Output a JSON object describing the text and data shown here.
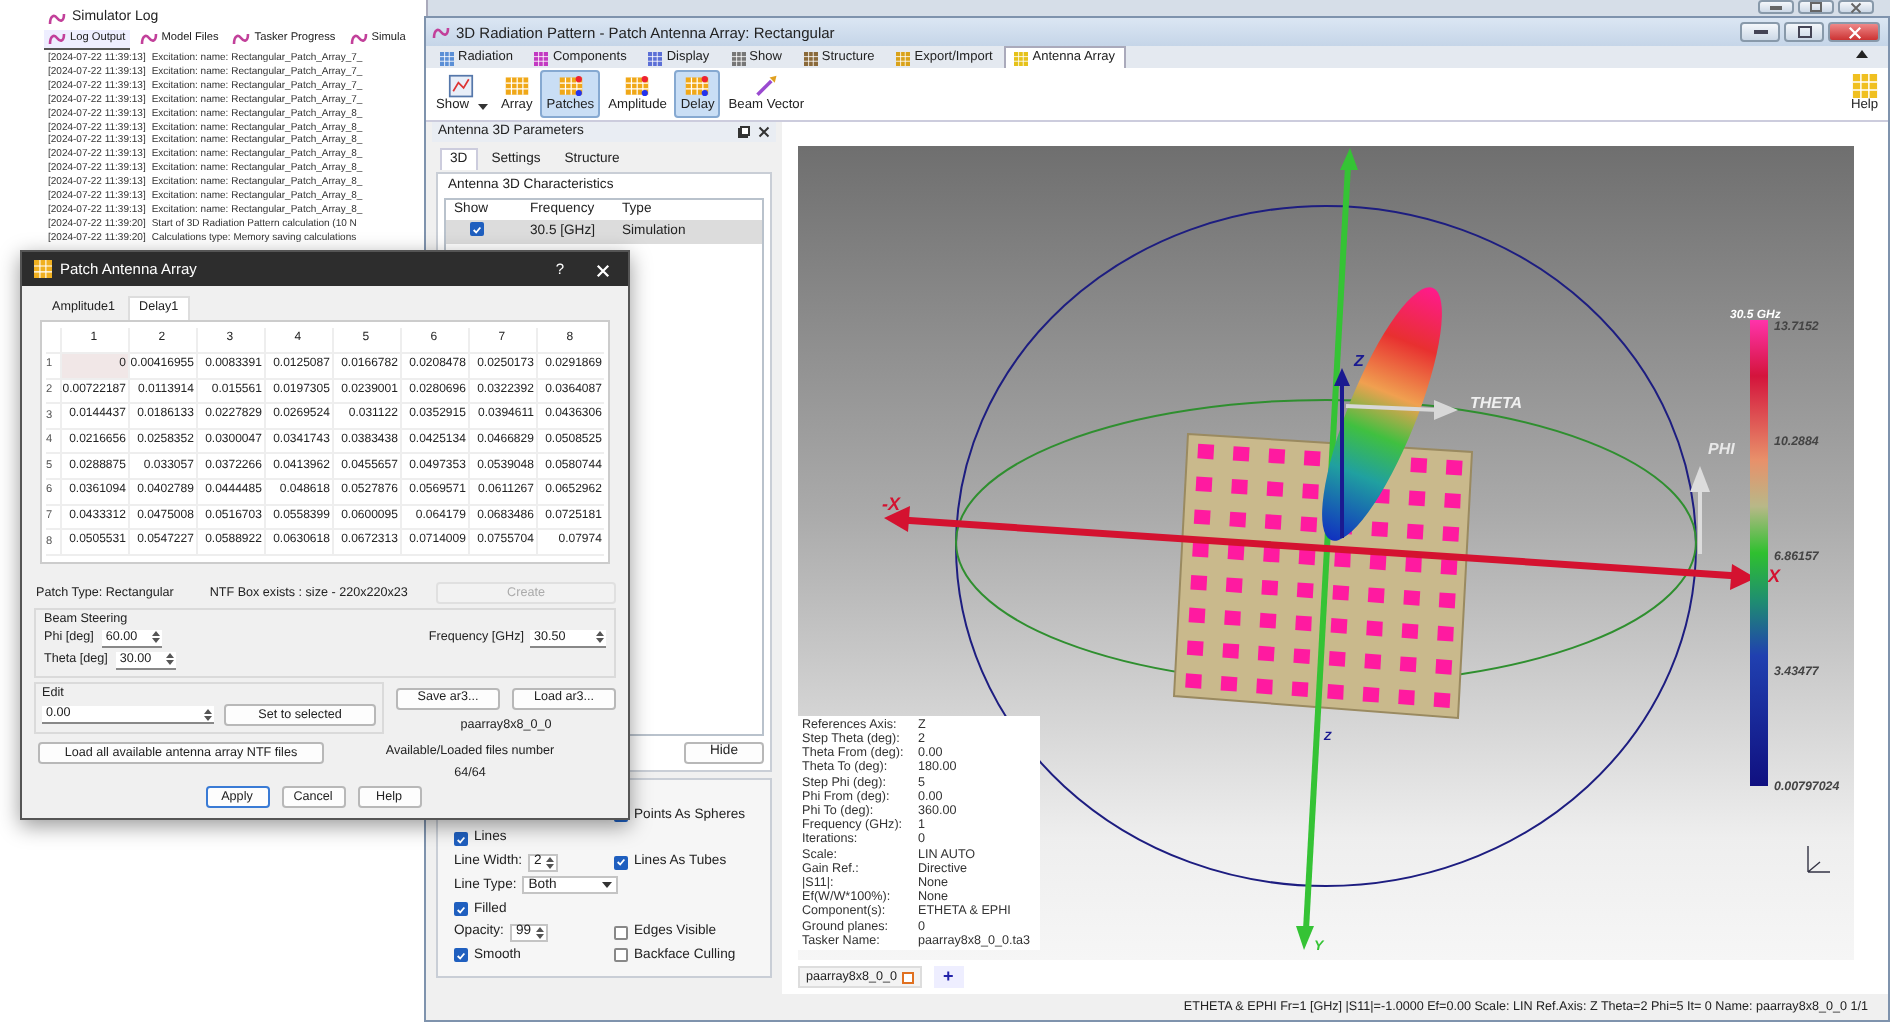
{
  "simulator_log": {
    "title": "Simulator Log",
    "tabs": [
      {
        "label": "Log Output",
        "selected": true
      },
      {
        "label": "Model Files",
        "selected": false
      },
      {
        "label": "Tasker Progress",
        "selected": false
      },
      {
        "label": "Simula",
        "selected": false
      }
    ],
    "lines": [
      {
        "time": "[2024-07-22 11:39:13]",
        "message": "Excitation: name: Rectangular_Patch_Array_7_"
      },
      {
        "time": "[2024-07-22 11:39:13]",
        "message": "Excitation: name: Rectangular_Patch_Array_7_"
      },
      {
        "time": "[2024-07-22 11:39:13]",
        "message": "Excitation: name: Rectangular_Patch_Array_7_"
      },
      {
        "time": "[2024-07-22 11:39:13]",
        "message": "Excitation: name: Rectangular_Patch_Array_7_"
      },
      {
        "time": "[2024-07-22 11:39:13]",
        "message": "Excitation: name: Rectangular_Patch_Array_8_"
      },
      {
        "time": "[2024-07-22 11:39:13]",
        "message": "Excitation: name: Rectangular_Patch_Array_8_"
      },
      {
        "time": "[2024-07-22 11:39:13]",
        "message": "Excitation: name: Rectangular_Patch_Array_8_"
      },
      {
        "time": "[2024-07-22 11:39:13]",
        "message": "Excitation: name: Rectangular_Patch_Array_8_"
      },
      {
        "time": "[2024-07-22 11:39:13]",
        "message": "Excitation: name: Rectangular_Patch_Array_8_"
      },
      {
        "time": "[2024-07-22 11:39:13]",
        "message": "Excitation: name: Rectangular_Patch_Array_8_"
      },
      {
        "time": "[2024-07-22 11:39:13]",
        "message": "Excitation: name: Rectangular_Patch_Array_8_"
      },
      {
        "time": "[2024-07-22 11:39:13]",
        "message": "Excitation: name: Rectangular_Patch_Array_8_"
      },
      {
        "time": "[2024-07-22 11:39:20]",
        "message": "Start of 3D Radiation Pattern calculation (10 N"
      },
      {
        "time": "[2024-07-22 11:39:20]",
        "message": "Calculations type: Memory saving calculations"
      }
    ]
  },
  "main_window": {
    "title": "3D Radiation Pattern - Patch Antenna Array: Rectangular",
    "ribbon_tabs": [
      {
        "label": "Radiation",
        "selected": false
      },
      {
        "label": "Components",
        "selected": false
      },
      {
        "label": "Display",
        "selected": false
      },
      {
        "label": "Show",
        "selected": false
      },
      {
        "label": "Structure",
        "selected": false
      },
      {
        "label": "Export/Import",
        "selected": false
      },
      {
        "label": "Antenna Array",
        "selected": true
      }
    ],
    "toolbar": [
      {
        "label": "Show",
        "selected": false,
        "dropdown": true
      },
      {
        "label": "Array",
        "selected": false,
        "dropdown": false
      },
      {
        "label": "Patches",
        "selected": true,
        "dropdown": false
      },
      {
        "label": "Amplitude",
        "selected": false,
        "dropdown": false
      },
      {
        "label": "Delay",
        "selected": true,
        "dropdown": false
      },
      {
        "label": "Beam Vector",
        "selected": false,
        "dropdown": false
      }
    ],
    "help_button": "Help"
  },
  "parameters_panel": {
    "title": "Antenna 3D Parameters",
    "tabs": [
      {
        "label": "3D",
        "selected": true
      },
      {
        "label": "Settings",
        "selected": false
      },
      {
        "label": "Structure",
        "selected": false
      }
    ],
    "group_title": "Antenna 3D Characteristics",
    "columns": [
      "Show",
      "Frequency",
      "Type"
    ],
    "rows": [
      {
        "show": true,
        "frequency": "30.5 [GHz]",
        "type": "Simulation",
        "selected": true
      }
    ],
    "hide_button": "Hide",
    "display_rows": [
      {
        "right": {
          "kind": "checkbox",
          "label": "Points As Spheres",
          "checked": true
        }
      },
      {
        "left": {
          "kind": "checkbox",
          "label": "Lines",
          "checked": true
        }
      },
      {
        "left": {
          "kind": "spinner",
          "label": "Line Width:",
          "value": "2"
        },
        "right": {
          "kind": "checkbox",
          "label": "Lines As Tubes",
          "checked": true
        }
      },
      {
        "left": {
          "kind": "select",
          "label": "Line Type:",
          "value": "Both"
        }
      },
      {
        "left": {
          "kind": "checkbox",
          "label": "Filled",
          "checked": true
        }
      },
      {
        "left": {
          "kind": "spinner",
          "label": "Opacity:",
          "value": "99"
        },
        "right": {
          "kind": "checkbox",
          "label": "Edges Visible",
          "checked": false
        }
      },
      {
        "left": {
          "kind": "checkbox",
          "label": "Smooth",
          "checked": true
        },
        "right": {
          "kind": "checkbox",
          "label": "Backface Culling",
          "checked": false
        }
      }
    ]
  },
  "viewer": {
    "axis_labels": {
      "minus_x": "-X",
      "x": "X",
      "z_top": "Z",
      "z_bottom": "Z",
      "y": "Y",
      "theta": "THETA",
      "phi": "PHI"
    },
    "color_scale": {
      "title": "30.5 GHz",
      "labels": [
        "13.7152",
        "10.2884",
        "6.86157",
        "3.43477",
        "0.00797024"
      ]
    },
    "info": [
      {
        "key": "References Axis:",
        "value": "Z"
      },
      {
        "key": "Step Theta (deg):",
        "value": "2"
      },
      {
        "key": "Theta From (deg):",
        "value": "0.00"
      },
      {
        "key": "Theta To (deg):",
        "value": "180.00"
      },
      {
        "key": "Step Phi (deg):",
        "value": "5"
      },
      {
        "key": "Phi From (deg):",
        "value": "0.00"
      },
      {
        "key": "Phi To (deg):",
        "value": "360.00"
      },
      {
        "key": "Frequency (GHz):",
        "value": "1"
      },
      {
        "key": "Iterations:",
        "value": "0"
      },
      {
        "key": "Scale:",
        "value": "LIN AUTO"
      },
      {
        "key": "Gain Ref.:",
        "value": "Directive"
      },
      {
        "key": "|S11|:",
        "value": "None"
      },
      {
        "key": "Ef(W/W*100%):",
        "value": "None"
      },
      {
        "key": "Component(s):",
        "value": "ETHETA & EPHI"
      },
      {
        "key": "Ground planes:",
        "value": "0"
      },
      {
        "key": "Tasker Name:",
        "value": "paarray8x8_0_0.ta3"
      }
    ],
    "tabs": [
      {
        "label": "paarray8x8_0_0",
        "selected": true
      }
    ],
    "add_tab": "+"
  },
  "status_bar": "ETHETA & EPHI Fr=1 [GHz] |S11|=-1.0000 Ef=0.00 Scale: LIN Ref.Axis: Z Theta=2 Phi=5 It= 0 Name: paarray8x8_0_0 1/1",
  "dialog": {
    "title": "Patch Antenna Array",
    "help": "?",
    "tabs": [
      {
        "label": "Amplitude1",
        "selected": false
      },
      {
        "label": "Delay1",
        "selected": true
      }
    ],
    "table": {
      "columns": [
        "1",
        "2",
        "3",
        "4",
        "5",
        "6",
        "7",
        "8"
      ],
      "rows": [
        {
          "label": "1",
          "cells": [
            {
              "v": "0",
              "selected": true
            },
            {
              "v": "0.00416955",
              "selected": false
            },
            {
              "v": "0.0083391",
              "selected": false
            },
            {
              "v": "0.0125087",
              "selected": false
            },
            {
              "v": "0.0166782",
              "selected": false
            },
            {
              "v": "0.0208478",
              "selected": false
            },
            {
              "v": "0.0250173",
              "selected": false
            },
            {
              "v": "0.0291869",
              "selected": false
            }
          ]
        },
        {
          "label": "2",
          "cells": [
            {
              "v": "0.00722187",
              "selected": false
            },
            {
              "v": "0.0113914",
              "selected": false
            },
            {
              "v": "0.015561",
              "selected": false
            },
            {
              "v": "0.0197305",
              "selected": false
            },
            {
              "v": "0.0239001",
              "selected": false
            },
            {
              "v": "0.0280696",
              "selected": false
            },
            {
              "v": "0.0322392",
              "selected": false
            },
            {
              "v": "0.0364087",
              "selected": false
            }
          ]
        },
        {
          "label": "3",
          "cells": [
            {
              "v": "0.0144437",
              "selected": false
            },
            {
              "v": "0.0186133",
              "selected": false
            },
            {
              "v": "0.0227829",
              "selected": false
            },
            {
              "v": "0.0269524",
              "selected": false
            },
            {
              "v": "0.031122",
              "selected": false
            },
            {
              "v": "0.0352915",
              "selected": false
            },
            {
              "v": "0.0394611",
              "selected": false
            },
            {
              "v": "0.0436306",
              "selected": false
            }
          ]
        },
        {
          "label": "4",
          "cells": [
            {
              "v": "0.0216656",
              "selected": false
            },
            {
              "v": "0.0258352",
              "selected": false
            },
            {
              "v": "0.0300047",
              "selected": false
            },
            {
              "v": "0.0341743",
              "selected": false
            },
            {
              "v": "0.0383438",
              "selected": false
            },
            {
              "v": "0.0425134",
              "selected": false
            },
            {
              "v": "0.0466829",
              "selected": false
            },
            {
              "v": "0.0508525",
              "selected": false
            }
          ]
        },
        {
          "label": "5",
          "cells": [
            {
              "v": "0.0288875",
              "selected": false
            },
            {
              "v": "0.033057",
              "selected": false
            },
            {
              "v": "0.0372266",
              "selected": false
            },
            {
              "v": "0.0413962",
              "selected": false
            },
            {
              "v": "0.0455657",
              "selected": false
            },
            {
              "v": "0.0497353",
              "selected": false
            },
            {
              "v": "0.0539048",
              "selected": false
            },
            {
              "v": "0.0580744",
              "selected": false
            }
          ]
        },
        {
          "label": "6",
          "cells": [
            {
              "v": "0.0361094",
              "selected": false
            },
            {
              "v": "0.0402789",
              "selected": false
            },
            {
              "v": "0.0444485",
              "selected": false
            },
            {
              "v": "0.048618",
              "selected": false
            },
            {
              "v": "0.0527876",
              "selected": false
            },
            {
              "v": "0.0569571",
              "selected": false
            },
            {
              "v": "0.0611267",
              "selected": false
            },
            {
              "v": "0.0652962",
              "selected": false
            }
          ]
        },
        {
          "label": "7",
          "cells": [
            {
              "v": "0.0433312",
              "selected": false
            },
            {
              "v": "0.0475008",
              "selected": false
            },
            {
              "v": "0.0516703",
              "selected": false
            },
            {
              "v": "0.0558399",
              "selected": false
            },
            {
              "v": "0.0600095",
              "selected": false
            },
            {
              "v": "0.064179",
              "selected": false
            },
            {
              "v": "0.0683486",
              "selected": false
            },
            {
              "v": "0.0725181",
              "selected": false
            }
          ]
        },
        {
          "label": "8",
          "cells": [
            {
              "v": "0.0505531",
              "selected": false
            },
            {
              "v": "0.0547227",
              "selected": false
            },
            {
              "v": "0.0588922",
              "selected": false
            },
            {
              "v": "0.0630618",
              "selected": false
            },
            {
              "v": "0.0672313",
              "selected": false
            },
            {
              "v": "0.0714009",
              "selected": false
            },
            {
              "v": "0.0755704",
              "selected": false
            },
            {
              "v": "0.07974",
              "selected": false
            }
          ]
        }
      ]
    },
    "patch_type": "Patch Type: Rectangular",
    "ntf_box": "NTF Box exists : size - 220x220x23",
    "create_button": {
      "label": "Create",
      "disabled": true
    },
    "beam_steering": {
      "title": "Beam Steering",
      "phi_label": "Phi [deg]",
      "phi": "60.00",
      "theta_label": "Theta [deg]",
      "theta": "30.00",
      "frequency_label": "Frequency [GHz]",
      "frequency": "30.50"
    },
    "edit": {
      "title": "Edit",
      "value": "0.00",
      "set_button": "Set to selected"
    },
    "save_button": "Save ar3...",
    "load_button": "Load ar3...",
    "file_name": "paarray8x8_0_0",
    "load_all_button": "Load all available antenna array NTF files",
    "files_label": "Available/Loaded files number",
    "files_count": "64/64",
    "buttons": [
      "Apply",
      "Cancel",
      "Help"
    ]
  }
}
